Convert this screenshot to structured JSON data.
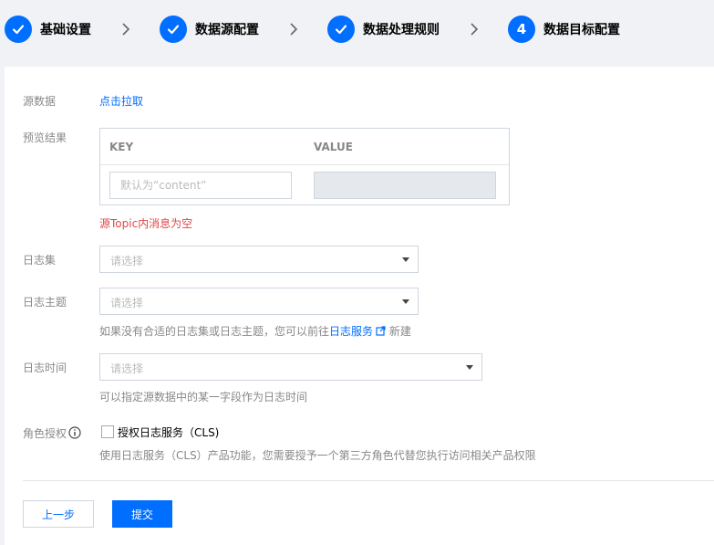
{
  "steps": [
    {
      "index": "1",
      "label": "基础设置",
      "state": "done"
    },
    {
      "index": "2",
      "label": "数据源配置",
      "state": "done"
    },
    {
      "index": "3",
      "label": "数据处理规则",
      "state": "done"
    },
    {
      "index": "4",
      "label": "数据目标配置",
      "state": "active"
    }
  ],
  "form": {
    "source_label": "源数据",
    "source_link": "点击拉取",
    "preview_label": "预览结果",
    "preview_table": {
      "key_header": "KEY",
      "value_header": "VALUE",
      "key_placeholder": "默认为“content”"
    },
    "empty_warning": "源Topic内消息为空",
    "logset_label": "日志集",
    "logset_placeholder": "请选择",
    "topic_label": "日志主题",
    "topic_placeholder": "请选择",
    "topic_hint_prefix": "如果没有合适的日志集或日志主题，您可以前往",
    "topic_hint_link": "日志服务",
    "topic_hint_suffix": "新建",
    "time_label": "日志时间",
    "time_placeholder": "请选择",
    "time_hint": "可以指定源数据中的某一字段作为日志时间",
    "role_label": "角色授权",
    "role_checkbox_label": "授权日志服务（CLS)",
    "role_hint": "使用日志服务（CLS）产品功能，您需要授予一个第三方角色代替您执行访问相关产品权限"
  },
  "actions": {
    "prev_label": "上一步",
    "submit_label": "提交"
  },
  "colors": {
    "accent": "#006eff",
    "warning": "#e54545",
    "background": "#f1f2f5"
  },
  "icons": {
    "step_done": "check-icon",
    "separator": "chevron-right-icon",
    "info": "info-icon",
    "external": "external-link-icon"
  }
}
